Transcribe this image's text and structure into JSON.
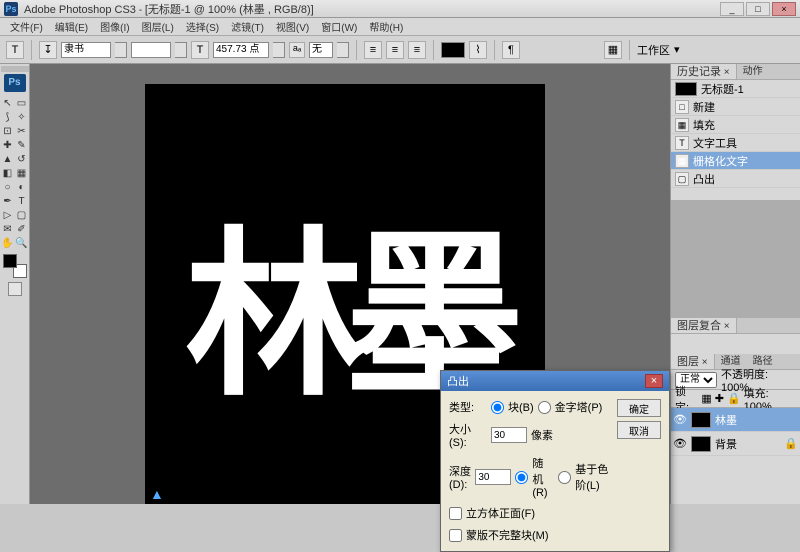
{
  "titlebar": {
    "app": "Adobe Photoshop CS3",
    "doc": "[无标题-1 @ 100% (林墨 , RGB/8)]"
  },
  "menu": [
    "文件(F)",
    "编辑(E)",
    "图像(I)",
    "图层(L)",
    "选择(S)",
    "滤镜(T)",
    "视图(V)",
    "窗口(W)",
    "帮助(H)"
  ],
  "optbar": {
    "font": "隶书",
    "size": "457.73 点",
    "aa": "无",
    "workspace": "工作区"
  },
  "canvas": {
    "text": "林墨"
  },
  "history": {
    "tab1": "历史记录",
    "tab2": "动作",
    "doc": "无标题-1",
    "items": [
      {
        "icon": "□",
        "label": "新建"
      },
      {
        "icon": "▦",
        "label": "填充"
      },
      {
        "icon": "T",
        "label": "文字工具"
      },
      {
        "icon": "▦",
        "label": "栅格化文字",
        "sel": true
      },
      {
        "icon": "▢",
        "label": "凸出"
      }
    ]
  },
  "layerfx": {
    "tab": "图层复合"
  },
  "layers": {
    "tabs": [
      "图层",
      "通道",
      "路径"
    ],
    "blend": "正常",
    "opacity_label": "不透明度:",
    "opacity": "100%",
    "lock": "锁定:",
    "fill_label": "填充:",
    "fill": "100%",
    "items": [
      {
        "name": "林墨",
        "sel": true,
        "bg": "#000"
      },
      {
        "name": "背景",
        "bg": "#000",
        "locked": true
      }
    ]
  },
  "dialog": {
    "title": "凸出",
    "type_label": "类型:",
    "type_block": "块(B)",
    "type_pyramid": "金字塔(P)",
    "size_label": "大小(S):",
    "size": "30",
    "size_unit": "像素",
    "depth_label": "深度(D):",
    "depth": "30",
    "depth_random": "随机(R)",
    "depth_level": "基于色阶(L)",
    "cb1": "立方体正面(F)",
    "cb2": "蒙版不完整块(M)",
    "ok": "确定",
    "cancel": "取消"
  }
}
